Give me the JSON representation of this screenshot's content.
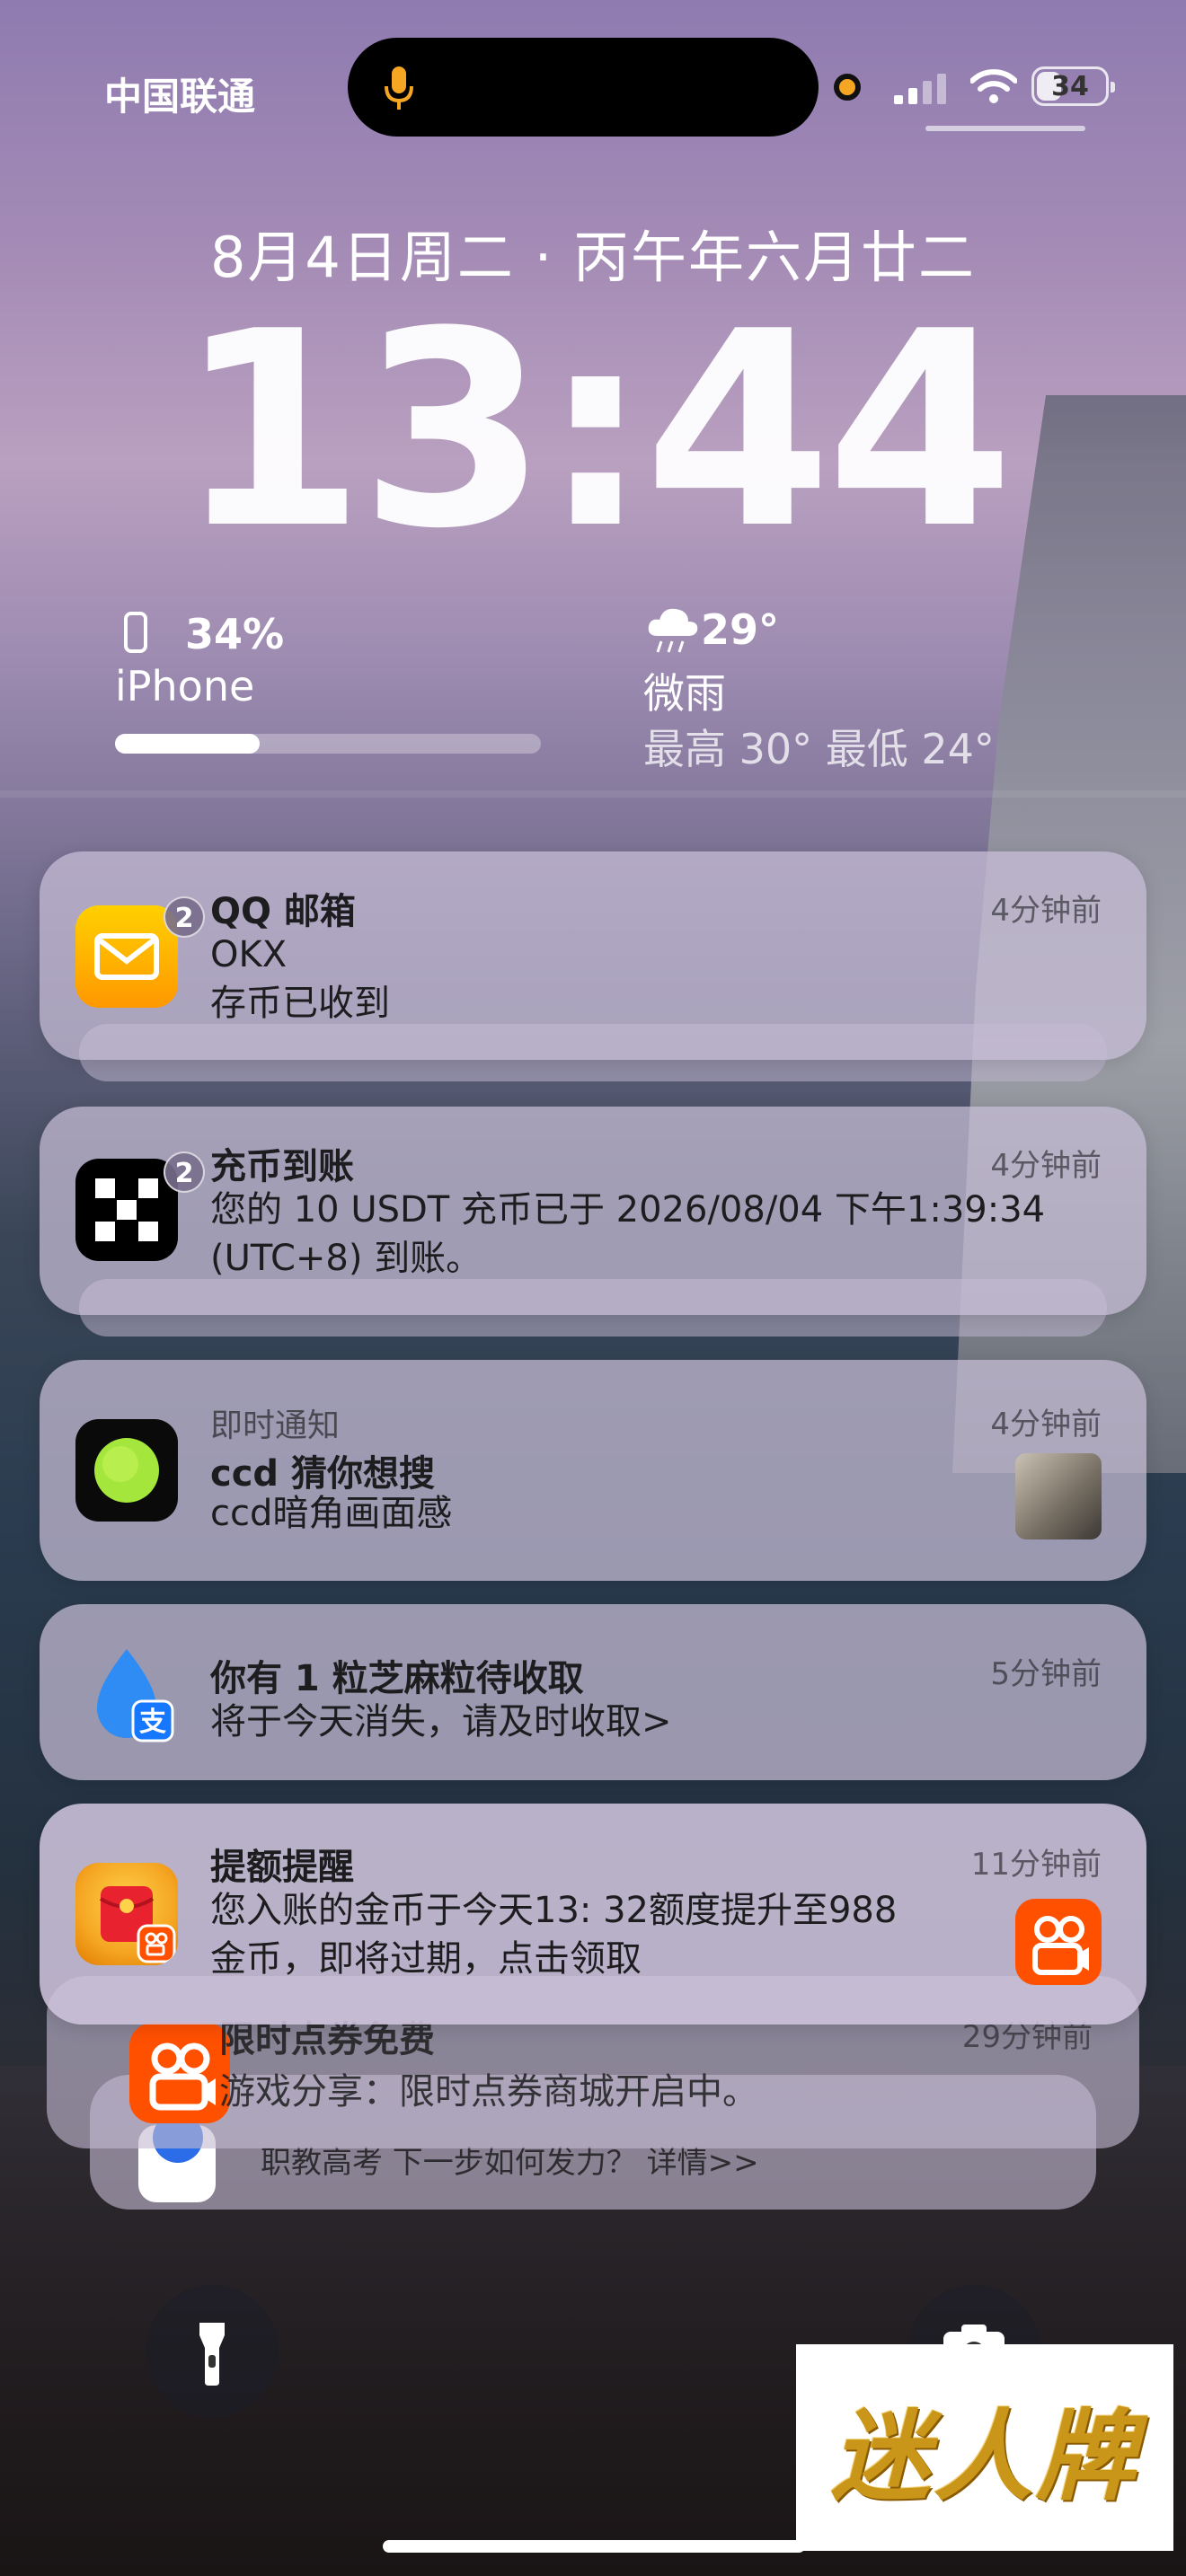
{
  "status_bar": {
    "carrier": "中国联通",
    "battery_level": "34",
    "colors": {
      "mic_indicator": "#f5a623",
      "camera_indicator": "#f5a623"
    }
  },
  "lock_screen": {
    "date": "8月4日周二 · 丙午年六月廿二",
    "time": "13:44"
  },
  "widgets": {
    "battery": {
      "percent": "34%",
      "device": "iPhone",
      "level": 0.34
    },
    "weather": {
      "temp": "29°",
      "condition": "微雨",
      "range": "最高 30° 最低 24°"
    }
  },
  "notifications": [
    {
      "app": "QQ邮箱",
      "badge": "2",
      "title": "QQ 邮箱",
      "line1": "OKX",
      "line2": "存币已收到",
      "time": "4分钟前",
      "icon": "mail-icon",
      "color": "#ffb300"
    },
    {
      "app": "OKX",
      "badge": "2",
      "title": "充币到账",
      "line1": "您的 10 USDT 充币已于 2026/08/04 下午1:39:34",
      "line2": "(UTC+8) 到账。",
      "time": "4分钟前",
      "icon": "okx-icon",
      "color": "#000000"
    },
    {
      "app": "即时通知",
      "subtitle": "即时通知",
      "title": "ccd 猜你想搜",
      "line1": "ccd暗角画面感",
      "time": "4分钟前",
      "icon": "soul-dot-icon",
      "color": "#a4e63c"
    },
    {
      "app": "支付宝",
      "title": "你有 1 粒芝麻粒待收取",
      "line1": "将于今天消失，请及时收取>",
      "time": "5分钟前",
      "icon": "alipay-icon",
      "color": "#1677ff"
    },
    {
      "app": "快手",
      "title": "提额提醒",
      "line1": "您入账的金币于今天13: 32额度提升至988",
      "line2": "金币，即将过期，点击领取",
      "time": "11分钟前",
      "icon": "redpacket-icon",
      "color": "#ff5000"
    }
  ],
  "stacked": [
    {
      "title": "限时点券免费",
      "line1": "游戏分享：限时点券商城开启中。",
      "time": "29分钟前"
    },
    {
      "line1": "职教高考  下一步如何发力？ 详情>>"
    }
  ],
  "quick_actions": {
    "left": "flashlight-icon",
    "right": "camera-icon"
  },
  "watermark": {
    "text": "迷人牌"
  }
}
